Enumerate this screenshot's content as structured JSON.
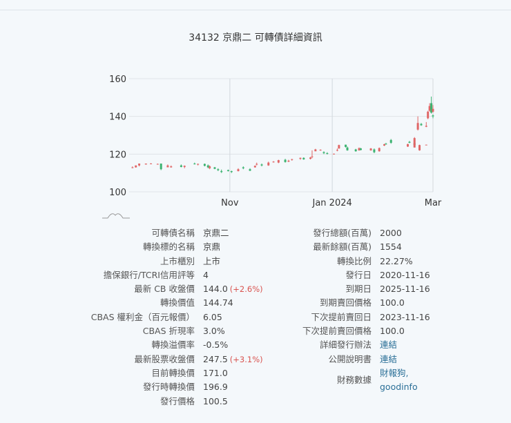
{
  "title": "34132 京鼎二 可轉債詳細資訊",
  "chart_data": {
    "type": "candlestick",
    "ylim": [
      100,
      160
    ],
    "yticks": [
      "100",
      "120",
      "140",
      "160"
    ],
    "xticks": [
      {
        "label": "Nov",
        "date": "2023-11-01"
      },
      {
        "label": "Jan 2024",
        "date": "2024-01-01"
      },
      {
        "label": "Mar",
        "date": "2024-03-01"
      }
    ],
    "xrange": [
      "2023-09-02",
      "2024-03-01"
    ],
    "up_color": "#e06666",
    "down_color": "#3cb371",
    "candles": [
      [
        "2023-09-04",
        113,
        113.5,
        112.5,
        113
      ],
      [
        "2023-09-06",
        113,
        114,
        112.8,
        114
      ],
      [
        "2023-09-08",
        114,
        115,
        113.5,
        115
      ],
      [
        "2023-09-12",
        114.5,
        115,
        114.5,
        115
      ],
      [
        "2023-09-15",
        115,
        115.2,
        114.8,
        115
      ],
      [
        "2023-09-19",
        114.8,
        115,
        114.5,
        114.8
      ],
      [
        "2023-09-21",
        115,
        115,
        111.5,
        112
      ],
      [
        "2023-09-25",
        113,
        114.5,
        113,
        114
      ],
      [
        "2023-09-27",
        113,
        114,
        112.8,
        113.5
      ],
      [
        "2023-10-03",
        114,
        114.5,
        113,
        113.2
      ],
      [
        "2023-10-05",
        113.2,
        114,
        112.5,
        113.8
      ],
      [
        "2023-10-11",
        115,
        115.5,
        114.5,
        114.6
      ],
      [
        "2023-10-13",
        114.5,
        115,
        114,
        114.8
      ],
      [
        "2023-10-17",
        114.8,
        115,
        113.5,
        113.8
      ],
      [
        "2023-10-19",
        114,
        114.5,
        112.5,
        113
      ],
      [
        "2023-10-20",
        112.5,
        114,
        112,
        113.5
      ],
      [
        "2023-10-23",
        113,
        113.2,
        112,
        112.2
      ],
      [
        "2023-10-25",
        112,
        112.5,
        111,
        111.5
      ],
      [
        "2023-10-27",
        111,
        111.8,
        110,
        110.5
      ],
      [
        "2023-10-31",
        111.5,
        111.8,
        110.8,
        111
      ],
      [
        "2023-11-02",
        111,
        111.2,
        110,
        110.5
      ],
      [
        "2023-11-06",
        111,
        112.5,
        110.8,
        112
      ],
      [
        "2023-11-09",
        113,
        113.5,
        112,
        112.5
      ],
      [
        "2023-11-13",
        112,
        112.5,
        111,
        111.2
      ],
      [
        "2023-11-16",
        113,
        114,
        112.8,
        113.8
      ],
      [
        "2023-11-17",
        114.5,
        115.5,
        114,
        114.8
      ],
      [
        "2023-11-20",
        114.5,
        115,
        113.5,
        114
      ],
      [
        "2023-11-24",
        114,
        116,
        113.8,
        115.5
      ],
      [
        "2023-11-27",
        116,
        116.3,
        115.5,
        116
      ],
      [
        "2023-11-30",
        115.5,
        117,
        115.2,
        116.8
      ],
      [
        "2023-12-04",
        117,
        117.5,
        115.5,
        115.8
      ],
      [
        "2023-12-06",
        116,
        117,
        115.8,
        116.5
      ],
      [
        "2023-12-08",
        117,
        117.5,
        116.5,
        117.3
      ],
      [
        "2023-12-13",
        117.5,
        118.2,
        117,
        118
      ],
      [
        "2023-12-15",
        118,
        118.3,
        117,
        117.2
      ],
      [
        "2023-12-19",
        117.5,
        118.5,
        117.2,
        118.2
      ],
      [
        "2023-12-20",
        118.5,
        122,
        117.8,
        118.8
      ],
      [
        "2023-12-22",
        121.5,
        122.8,
        121.5,
        122.5
      ],
      [
        "2023-12-25",
        122,
        122.5,
        121.8,
        122.3
      ],
      [
        "2023-12-27",
        121,
        121.5,
        120,
        120.5
      ],
      [
        "2023-12-29",
        120.5,
        121,
        119.8,
        120.2
      ],
      [
        "2024-01-02",
        120,
        120.3,
        119.8,
        120.2
      ],
      [
        "2024-01-04",
        122,
        123,
        121.5,
        122.2
      ],
      [
        "2024-01-05",
        123,
        125,
        122.8,
        124.8
      ],
      [
        "2024-01-09",
        125,
        125,
        123.5,
        123.8
      ],
      [
        "2024-01-10",
        123.5,
        124,
        121.8,
        122
      ],
      [
        "2024-01-15",
        122.5,
        122.8,
        121.3,
        121.5
      ],
      [
        "2024-01-17",
        122,
        123.5,
        121.8,
        123.2
      ],
      [
        "2024-01-18",
        123,
        123.3,
        122,
        122.2
      ],
      [
        "2024-01-24",
        122,
        123.2,
        121.8,
        123
      ],
      [
        "2024-01-26",
        122.5,
        123,
        120.5,
        121
      ],
      [
        "2024-01-29",
        121.5,
        123.5,
        121.3,
        123.2
      ],
      [
        "2024-02-01",
        124.5,
        125.5,
        124.3,
        125.2
      ],
      [
        "2024-02-02",
        125.5,
        126,
        125,
        125.3
      ],
      [
        "2024-02-05",
        127.5,
        128,
        125.5,
        126
      ],
      [
        "2024-02-15",
        124,
        125.5,
        123.8,
        125.3
      ],
      [
        "2024-02-16",
        126.5,
        127,
        125.8,
        126
      ],
      [
        "2024-02-19",
        125.8,
        126.2,
        124.5,
        124.8
      ],
      [
        "2024-02-22",
        122,
        125,
        121.8,
        124.8
      ],
      [
        "2024-02-26",
        125,
        125,
        124.8,
        125
      ],
      [
        "2024-02-19",
        123.5,
        129,
        123.5,
        128.5
      ],
      [
        "2024-02-21",
        133,
        140,
        132.5,
        136.5
      ],
      [
        "2024-02-23",
        136,
        136.5,
        135,
        135.3
      ],
      [
        "2024-02-26",
        134.5,
        137,
        134.3,
        135
      ],
      [
        "2024-02-27",
        139,
        143,
        138.5,
        142.5
      ],
      [
        "2024-02-28",
        143,
        147,
        142.5,
        145.5
      ],
      [
        "2024-02-29",
        147,
        150.5,
        143.5,
        144
      ],
      [
        "2024-02-29",
        145,
        146,
        141.5,
        142
      ],
      [
        "2024-03-01",
        140.5,
        141,
        139,
        140
      ],
      [
        "2024-03-01",
        142.5,
        146,
        142,
        144
      ]
    ]
  },
  "left": [
    {
      "label": "可轉債名稱",
      "value": "京鼎二"
    },
    {
      "label": "轉換標的名稱",
      "value": "京鼎"
    },
    {
      "label": "上市櫃別",
      "value": "上市"
    },
    {
      "label": "擔保銀行/TCRI信用評等",
      "value": "4"
    },
    {
      "label": "最新 CB 收盤價",
      "value": "144.0",
      "change": "(+2.6%)"
    },
    {
      "label": "轉換價值",
      "value": "144.74"
    },
    {
      "label": "CBAS 權利金（百元報價）",
      "value": "6.05"
    },
    {
      "label": "CBAS 折現率",
      "value": "3.0%"
    },
    {
      "label": "轉換溢價率",
      "value": "-0.5%"
    },
    {
      "label": "最新股票收盤價",
      "value": "247.5",
      "change": "(+3.1%)"
    },
    {
      "label": "目前轉換價",
      "value": "171.0"
    },
    {
      "label": "發行時轉換價",
      "value": "196.9"
    },
    {
      "label": "發行價格",
      "value": "100.5"
    }
  ],
  "right": [
    {
      "label": "發行總額(百萬)",
      "value": "2000"
    },
    {
      "label": "最新餘額(百萬)",
      "value": "1554"
    },
    {
      "label": "轉換比例",
      "value": "22.27%"
    },
    {
      "label": "發行日",
      "value": "2020-11-16"
    },
    {
      "label": "到期日",
      "value": "2025-11-16"
    },
    {
      "label": "到期賣回價格",
      "value": "100.0"
    },
    {
      "label": "下次提前賣回日",
      "value": "2023-11-16"
    },
    {
      "label": "下次提前賣回價格",
      "value": "100.0"
    },
    {
      "label": "詳細發行辦法",
      "link": "連結"
    },
    {
      "label": "公開說明書",
      "link": "連結"
    },
    {
      "label": "財務數據",
      "links": [
        "財報狗,",
        "goodinfo"
      ]
    }
  ]
}
